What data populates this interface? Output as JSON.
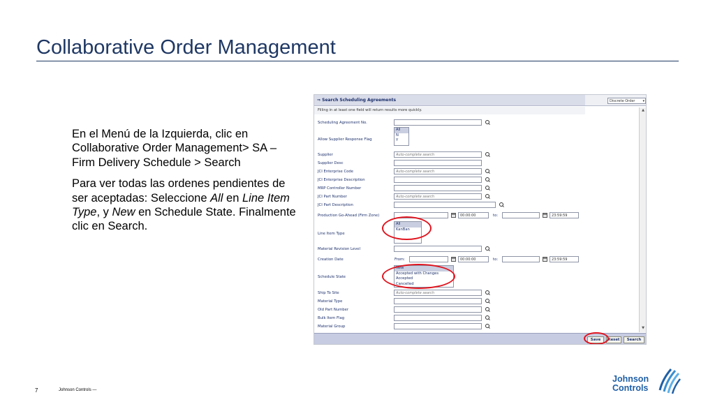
{
  "slide": {
    "title": "Collaborative Order Management",
    "paragraph1": "En el Menú de la Izquierda, clic en Collaborative Order Management> SA – Firm Delivery Schedule > Search",
    "p2_a": "Para ver todas las ordenes pendientes de ser aceptadas: Seleccione ",
    "p2_b": "All",
    "p2_c": " en ",
    "p2_d": "Line Item Type",
    "p2_e": ", y ",
    "p2_f": "New",
    "p2_g": " en Schedule State. Finalmente clic en Search.",
    "page_number": "7",
    "footer": "Johnson Controls  —",
    "logo_line1": "Johnson",
    "logo_line2": "Controls"
  },
  "panel": {
    "header": "⇒ Search Scheduling Agreements",
    "note": "Filling in at least one field will return results more quickly.",
    "discrete_select": "Discrete Order",
    "placeholder": "Auto-complete search",
    "labels": {
      "scheduling_agreement": "Scheduling Agreement No.",
      "allow_supplier": "Allow Supplier Response Flag",
      "supplier": "Supplier",
      "supplier_desc": "Supplier Desc",
      "jci_enterprise_code": "JCI Enterprise Code",
      "jci_enterprise_desc": "JCI Enterprise Description",
      "mrp_controller": "MRP Controller Number",
      "jci_part_number": "JCI Part Number",
      "jci_part_desc": "JCI Part Description",
      "production_go_ahead": "Production Go-Ahead (Firm Zone)",
      "line_item_type": "Line Item Type",
      "material_revision": "Material Revision Level",
      "creation_date": "Creation Date",
      "schedule_state": "Schedule State",
      "ship_to_site": "Ship To Site",
      "material_type": "Material Type",
      "old_part_number": "Old Part Number",
      "bulk_item_flag": "Bulk Item Flag",
      "material_group": "Material Group",
      "from": "From:",
      "to": "to:"
    },
    "allow_supplier_options": [
      "All",
      "N",
      "Y"
    ],
    "line_item_type_options": [
      "All",
      "KanBan"
    ],
    "schedule_state_options": [
      "New",
      "Accepted with Changes",
      "Accepted",
      "Cancelled"
    ],
    "time_from": "00:00:00",
    "time_to": "23:59:59",
    "buttons": {
      "save": "Save",
      "reset": "Reset",
      "search": "Search"
    }
  }
}
